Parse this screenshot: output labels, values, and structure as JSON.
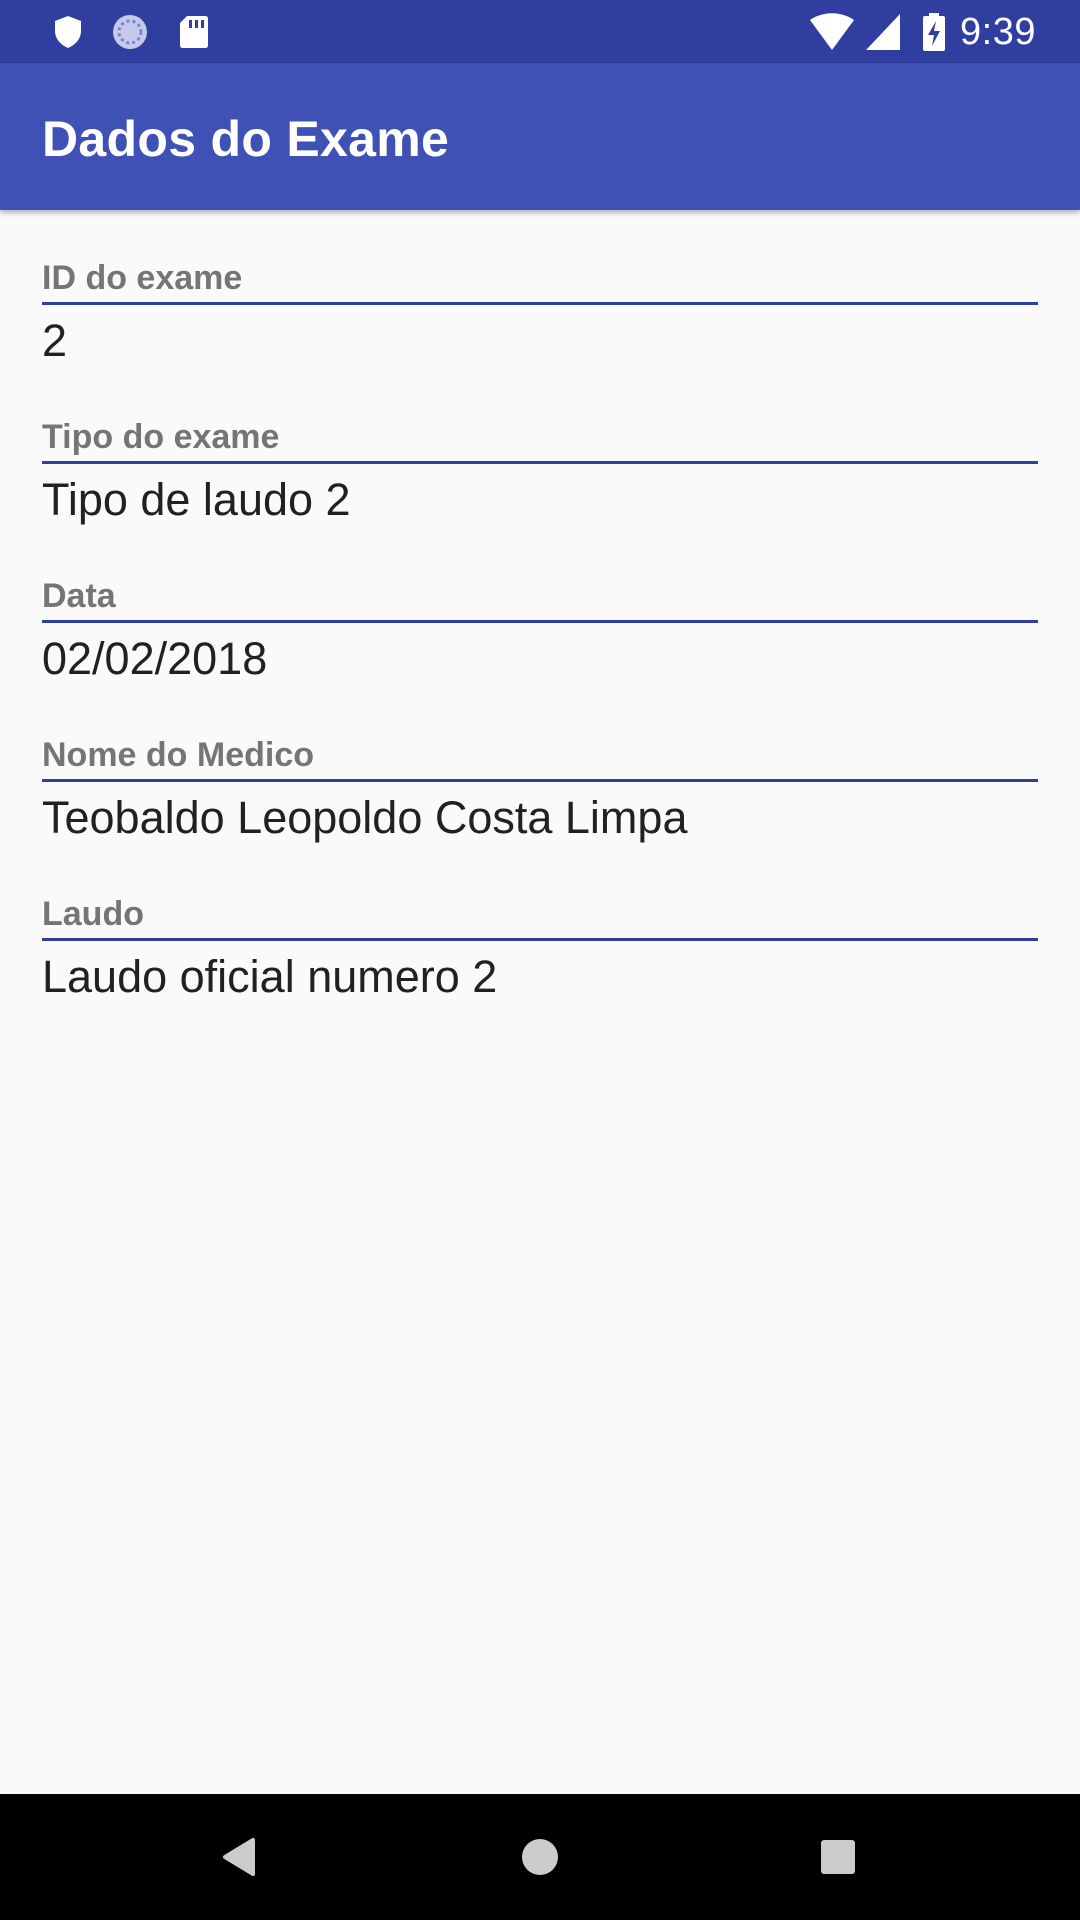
{
  "status_bar": {
    "time": "9:39",
    "icons_left": [
      "shield-icon",
      "sync-icon",
      "sd-card-icon"
    ],
    "icons_right": [
      "wifi-icon",
      "cell-signal-icon",
      "battery-charging-icon"
    ]
  },
  "app_bar": {
    "title": "Dados do Exame"
  },
  "fields": [
    {
      "label": "ID do exame",
      "value": "2"
    },
    {
      "label": "Tipo do exame",
      "value": "Tipo de laudo 2"
    },
    {
      "label": "Data",
      "value": "02/02/2018"
    },
    {
      "label": "Nome do Medico",
      "value": "Teobaldo Leopoldo Costa Limpa"
    },
    {
      "label": "Laudo",
      "value": "Laudo oficial numero 2"
    }
  ],
  "nav_bar": {
    "buttons": [
      "back-icon",
      "home-icon",
      "recents-icon"
    ]
  },
  "colors": {
    "status_bar": "#303f9f",
    "app_bar": "#3f51b5",
    "underline": "#303f9f",
    "label": "#757575",
    "value": "#212121",
    "background": "#fafafa"
  }
}
